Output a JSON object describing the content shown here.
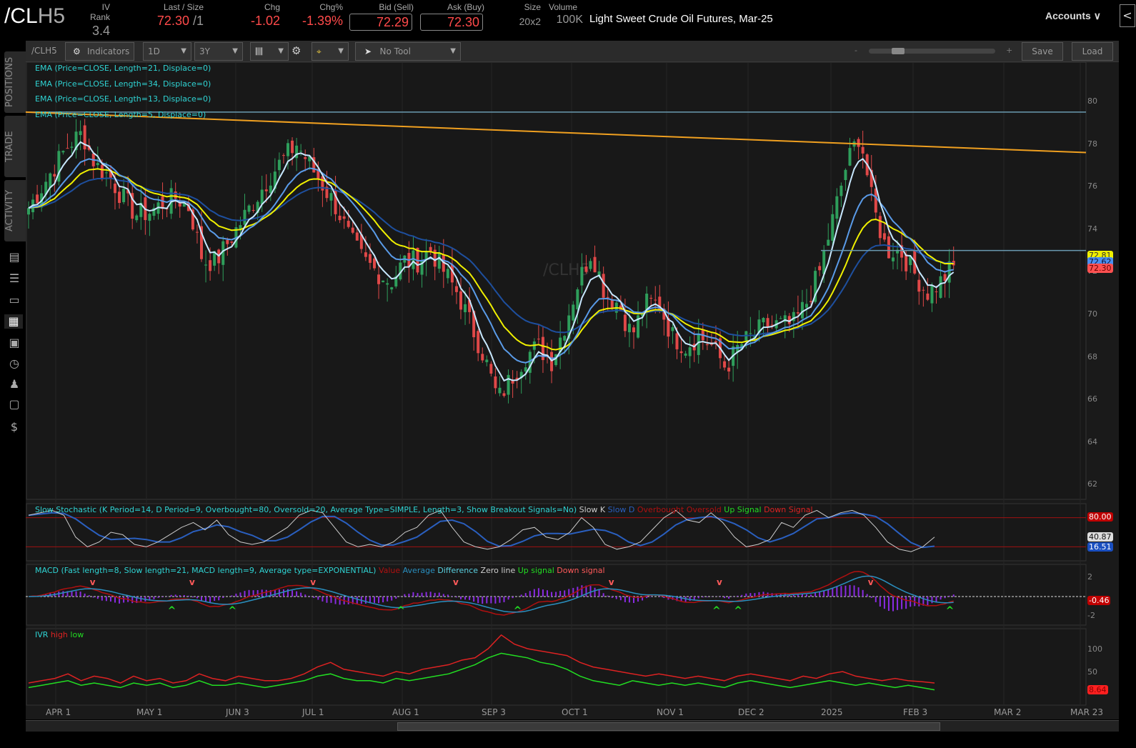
{
  "header": {
    "symbol_main": "/CL",
    "symbol_suffix": "H5",
    "fields": [
      {
        "label": "IV Rank",
        "value": "3.4"
      },
      {
        "label": "Last / Size",
        "value": "72.30",
        "size": "/1"
      },
      {
        "label": "Chg",
        "value": "-1.02"
      },
      {
        "label": "Chg%",
        "value": "-1.39%"
      },
      {
        "label": "Bid (Sell)",
        "value": "72.29"
      },
      {
        "label": "Ask (Buy)",
        "value": "72.30"
      },
      {
        "label": "Size",
        "value": "20x2"
      },
      {
        "label": "Volume",
        "value": "100K"
      }
    ],
    "description": "Light Sweet Crude Oil Futures, Mar-25",
    "accounts": "Accounts",
    "collapse": "<"
  },
  "sidebar": {
    "tabs": [
      "POSITIONS",
      "TRADE",
      "ACTIVITY"
    ]
  },
  "toolbar": {
    "symbol": "/CLH5",
    "indicators": "Indicators",
    "aggregation": "1D",
    "range": "3Y",
    "drawing_tool": "No Tool",
    "zoom_minus": "-",
    "zoom_plus": "+",
    "zoom_level": 0.18,
    "save": "Save",
    "load": "Load"
  },
  "studies": {
    "ema": [
      "EMA (Price=CLOSE, Length=21, Displace=0)",
      "EMA (Price=CLOSE, Length=34, Displace=0)",
      "EMA (Price=CLOSE, Length=13, Displace=0)",
      "EMA (Price=CLOSE, Length=5, Displace=0)"
    ],
    "stoch": {
      "title": "Slow Stochastic (K Period=14, D Period=9, Overbought=80, Oversold=20, Average Type=SIMPLE, Length=3, Show Breakout Signals=No)",
      "legend": [
        {
          "t": "Slow K",
          "c": "#cccccc"
        },
        {
          "t": "Slow D",
          "c": "#2a5fbf"
        },
        {
          "t": "Overbought",
          "c": "#b01010"
        },
        {
          "t": "Oversold",
          "c": "#b01010"
        },
        {
          "t": "Up Signal",
          "c": "#22dd22"
        },
        {
          "t": "Down Signal",
          "c": "#dd2222"
        }
      ]
    },
    "macd": {
      "title": "MACD (Fast length=8, Slow length=21, MACD length=9, Average type=EXPONENTIAL)",
      "legend": [
        {
          "t": "Value",
          "c": "#b01010"
        },
        {
          "t": "Average",
          "c": "#2a8fbf"
        },
        {
          "t": "Difference",
          "c": "#5ad0e0"
        },
        {
          "t": "Zero line",
          "c": "#cccccc"
        },
        {
          "t": "Up signal",
          "c": "#22dd22"
        },
        {
          "t": "Down signal",
          "c": "#ff5a5a"
        }
      ]
    },
    "ivr": {
      "title": "IVR",
      "legend": [
        {
          "t": "high",
          "c": "#dd2222"
        },
        {
          "t": "low",
          "c": "#22dd22"
        }
      ]
    }
  },
  "watermark": "/CLH5",
  "price_axis": {
    "ticks": [
      "80",
      "78",
      "76",
      "74",
      "72",
      "70",
      "68",
      "66",
      "64",
      "62"
    ],
    "badges": [
      {
        "v": "72.81",
        "bg": "#f0f000",
        "fg": "#333"
      },
      {
        "v": "72.62",
        "bg": "#4a8ff0",
        "fg": "#113"
      },
      {
        "v": "72.30",
        "bg": "#ff5050",
        "fg": "#600"
      }
    ]
  },
  "stoch_axis": {
    "ticks": [],
    "badges": [
      {
        "v": "80.00",
        "bg": "#c00000",
        "fg": "#fff"
      },
      {
        "v": "40.87",
        "bg": "#dddddd",
        "fg": "#111"
      },
      {
        "v": "16.51",
        "bg": "#1a4fc0",
        "fg": "#fff"
      }
    ]
  },
  "macd_axis": {
    "ticks": [
      "2",
      "-2"
    ],
    "badges": [
      {
        "v": "-0.46",
        "bg": "#c00000",
        "fg": "#fff"
      }
    ]
  },
  "ivr_axis": {
    "ticks": [
      "100",
      "50"
    ],
    "badges": [
      {
        "v": "8.64",
        "bg": "#ff2020",
        "fg": "#800"
      }
    ]
  },
  "x_axis": [
    "APR 1",
    "MAY 1",
    "JUN 3",
    "JUL 1",
    "AUG 1",
    "SEP 3",
    "OCT 1",
    "NOV 1",
    "DEC 2",
    "2025",
    "FEB 3",
    "MAR 2",
    "MAR 23"
  ],
  "chart_data": {
    "type": "candlestick",
    "ylim": [
      61,
      81.5
    ],
    "closes": [
      75,
      76,
      77,
      78,
      78.5,
      77,
      76.5,
      75.5,
      74.7,
      74.8,
      75.2,
      75.5,
      75,
      72.5,
      72.5,
      73.5,
      74.5,
      75.5,
      76.5,
      77.3,
      78,
      77,
      76,
      75,
      73.5,
      72.5,
      72,
      71.5,
      72.5,
      72.5,
      73,
      72,
      71,
      69.5,
      68,
      66,
      67,
      68,
      68.5,
      67.8,
      69.5,
      71.5,
      73,
      71,
      70.5,
      69,
      70.5,
      70.5,
      69,
      68.5,
      69,
      68.5,
      67.5,
      68.5,
      69,
      69.5,
      69.5,
      69.5,
      70.5,
      72,
      74.5,
      77,
      78.5,
      75,
      73,
      73,
      72,
      71,
      71.5,
      72.3
    ],
    "hlines": [
      79.5,
      73.0
    ],
    "trendline": [
      79.5,
      77.6
    ],
    "stoch_k": [
      85,
      90,
      95,
      85,
      40,
      20,
      30,
      50,
      45,
      25,
      20,
      30,
      45,
      60,
      70,
      55,
      75,
      45,
      30,
      25,
      30,
      45,
      60,
      85,
      95,
      90,
      60,
      30,
      20,
      25,
      20,
      30,
      50,
      60,
      85,
      95,
      60,
      30,
      20,
      15,
      20,
      35,
      55,
      60,
      40,
      35,
      50,
      80,
      60,
      25,
      15,
      20,
      30,
      55,
      80,
      95,
      75,
      70,
      90,
      70,
      40,
      20,
      25,
      35,
      70,
      60,
      85,
      95,
      80,
      90,
      95,
      85,
      60,
      30,
      15,
      10,
      20,
      40
    ],
    "ivr_high": [
      25,
      30,
      35,
      45,
      30,
      40,
      35,
      25,
      40,
      30,
      35,
      25,
      30,
      45,
      35,
      30,
      40,
      35,
      30,
      30,
      35,
      45,
      60,
      70,
      55,
      50,
      45,
      40,
      50,
      45,
      55,
      60,
      65,
      75,
      80,
      100,
      130,
      110,
      100,
      95,
      90,
      85,
      70,
      60,
      55,
      50,
      45,
      40,
      45,
      40,
      35,
      40,
      35,
      30,
      40,
      45,
      40,
      35,
      30,
      40,
      35,
      45,
      50,
      40,
      35,
      30,
      35,
      30,
      28,
      25
    ],
    "ivr_low": [
      15,
      20,
      25,
      30,
      20,
      25,
      20,
      15,
      25,
      20,
      25,
      15,
      20,
      30,
      20,
      20,
      25,
      20,
      15,
      20,
      25,
      30,
      40,
      45,
      35,
      30,
      30,
      25,
      35,
      30,
      35,
      40,
      45,
      55,
      65,
      80,
      90,
      85,
      80,
      70,
      65,
      55,
      40,
      30,
      25,
      20,
      30,
      25,
      20,
      25,
      20,
      25,
      20,
      15,
      25,
      30,
      25,
      20,
      15,
      20,
      25,
      30,
      25,
      20,
      25,
      20,
      15,
      20,
      15,
      10
    ]
  }
}
